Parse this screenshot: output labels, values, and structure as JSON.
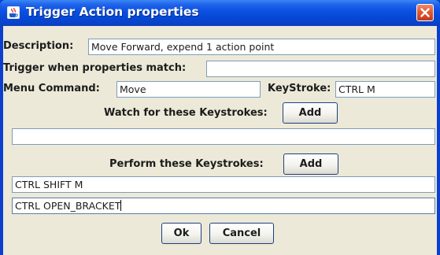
{
  "window": {
    "title": "Trigger Action properties"
  },
  "form": {
    "description_label": "Description:",
    "description_value": "Move Forward, expend 1 action point",
    "trigger_label": "Trigger when properties match:",
    "trigger_value": "",
    "menu_command_label": "Menu Command:",
    "menu_command_value": "Move",
    "keystroke_label": "KeyStroke:",
    "keystroke_value": "CTRL M",
    "watch_label": "Watch for these Keystrokes:",
    "watch_add_label": "Add",
    "watch_keystroke_value": "",
    "perform_label": "Perform these Keystrokes:",
    "perform_add_label": "Add",
    "perform_keystrokes": [
      "CTRL SHIFT M",
      "CTRL OPEN_BRACKET"
    ]
  },
  "buttons": {
    "ok_label": "Ok",
    "cancel_label": "Cancel"
  },
  "colors": {
    "titlebar": "#0a4fe0",
    "dialog_background": "#ece9d8",
    "close_button": "#e25a30",
    "field_border": "#7f9db9"
  },
  "icons": {
    "app_icon": "java-cup-icon",
    "close_icon": "close-icon"
  }
}
